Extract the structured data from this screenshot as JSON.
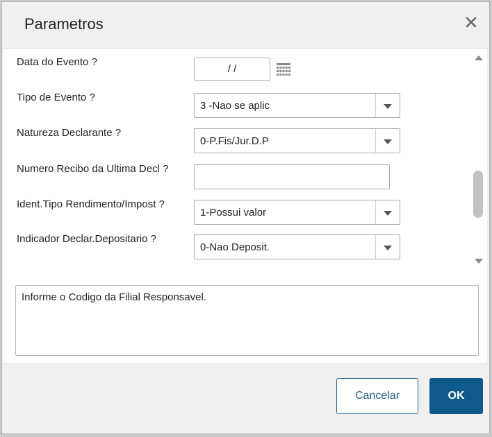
{
  "dialog": {
    "title": "Parametros",
    "help_text": "Informe o Codigo da Filial Responsavel.",
    "buttons": {
      "cancel": "Cancelar",
      "ok": "OK"
    }
  },
  "params": {
    "data_evento": {
      "label": "Data do Evento ?",
      "value": "/ /"
    },
    "tipo_evento": {
      "label": "Tipo de Evento ?",
      "value": "3 -Nao se aplic"
    },
    "natureza_declarante": {
      "label": "Natureza Declarante ?",
      "value": "0-P.Fis/Jur.D.P"
    },
    "numero_recibo": {
      "label": "Numero Recibo da Ultima Decl ?",
      "value": ""
    },
    "ident_tipo_rendimento": {
      "label": "Ident.Tipo Rendimento/Impost ?",
      "value": "1-Possui valor"
    },
    "indicador_depositario": {
      "label": "Indicador Declar.Depositario ?",
      "value": "0-Nao Deposit."
    }
  },
  "icons": {
    "close": "close-icon",
    "calendar": "calendar-icon",
    "dropdown": "chevron-down-icon"
  },
  "colors": {
    "primary": "#0f5a8c",
    "background": "#f0f0f0"
  }
}
